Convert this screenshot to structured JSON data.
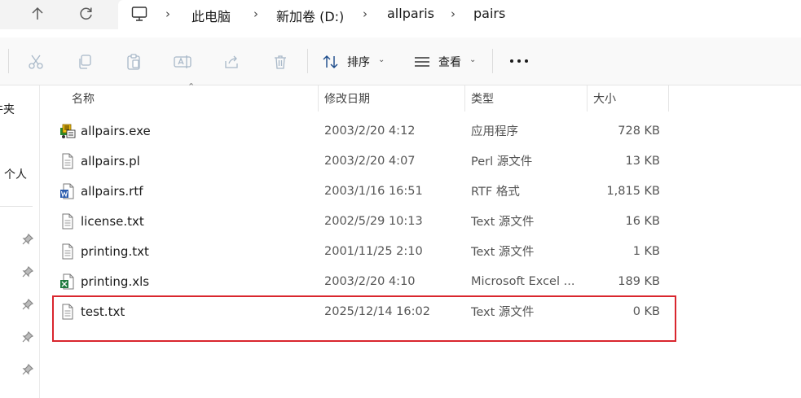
{
  "breadcrumb": [
    "此电脑",
    "新加卷 (D:)",
    "allparis",
    "pairs"
  ],
  "toolbar": {
    "sort_label": "排序",
    "view_label": "查看",
    "more_label": "···"
  },
  "leftpane": {
    "items": [
      "件夹",
      "个人"
    ]
  },
  "columns": {
    "name": "名称",
    "modified": "修改日期",
    "type": "类型",
    "size": "大小"
  },
  "files": [
    {
      "name": "allpairs.exe",
      "modified": "2003/2/20 4:12",
      "type": "应用程序",
      "size": "728 KB",
      "icon": "exe-icon"
    },
    {
      "name": "allpairs.pl",
      "modified": "2003/2/20 4:07",
      "type": "Perl 源文件",
      "size": "13 KB",
      "icon": "text-file-icon"
    },
    {
      "name": "allpairs.rtf",
      "modified": "2003/1/16 16:51",
      "type": "RTF 格式",
      "size": "1,815 KB",
      "icon": "word-file-icon"
    },
    {
      "name": "license.txt",
      "modified": "2002/5/29 10:13",
      "type": "Text 源文件",
      "size": "16 KB",
      "icon": "text-file-icon"
    },
    {
      "name": "printing.txt",
      "modified": "2001/11/25 2:10",
      "type": "Text 源文件",
      "size": "1 KB",
      "icon": "text-file-icon"
    },
    {
      "name": "printing.xls",
      "modified": "2003/2/20 4:10",
      "type": "Microsoft Excel ...",
      "size": "189 KB",
      "icon": "excel-file-icon"
    },
    {
      "name": "test.txt",
      "modified": "2025/12/14 16:02",
      "type": "Text 源文件",
      "size": "0 KB",
      "icon": "text-file-icon"
    }
  ],
  "colors": {
    "highlight_border": "#d9262e",
    "nav_background": "#f3f3f3",
    "toolbar_background": "#f9f9f9"
  }
}
